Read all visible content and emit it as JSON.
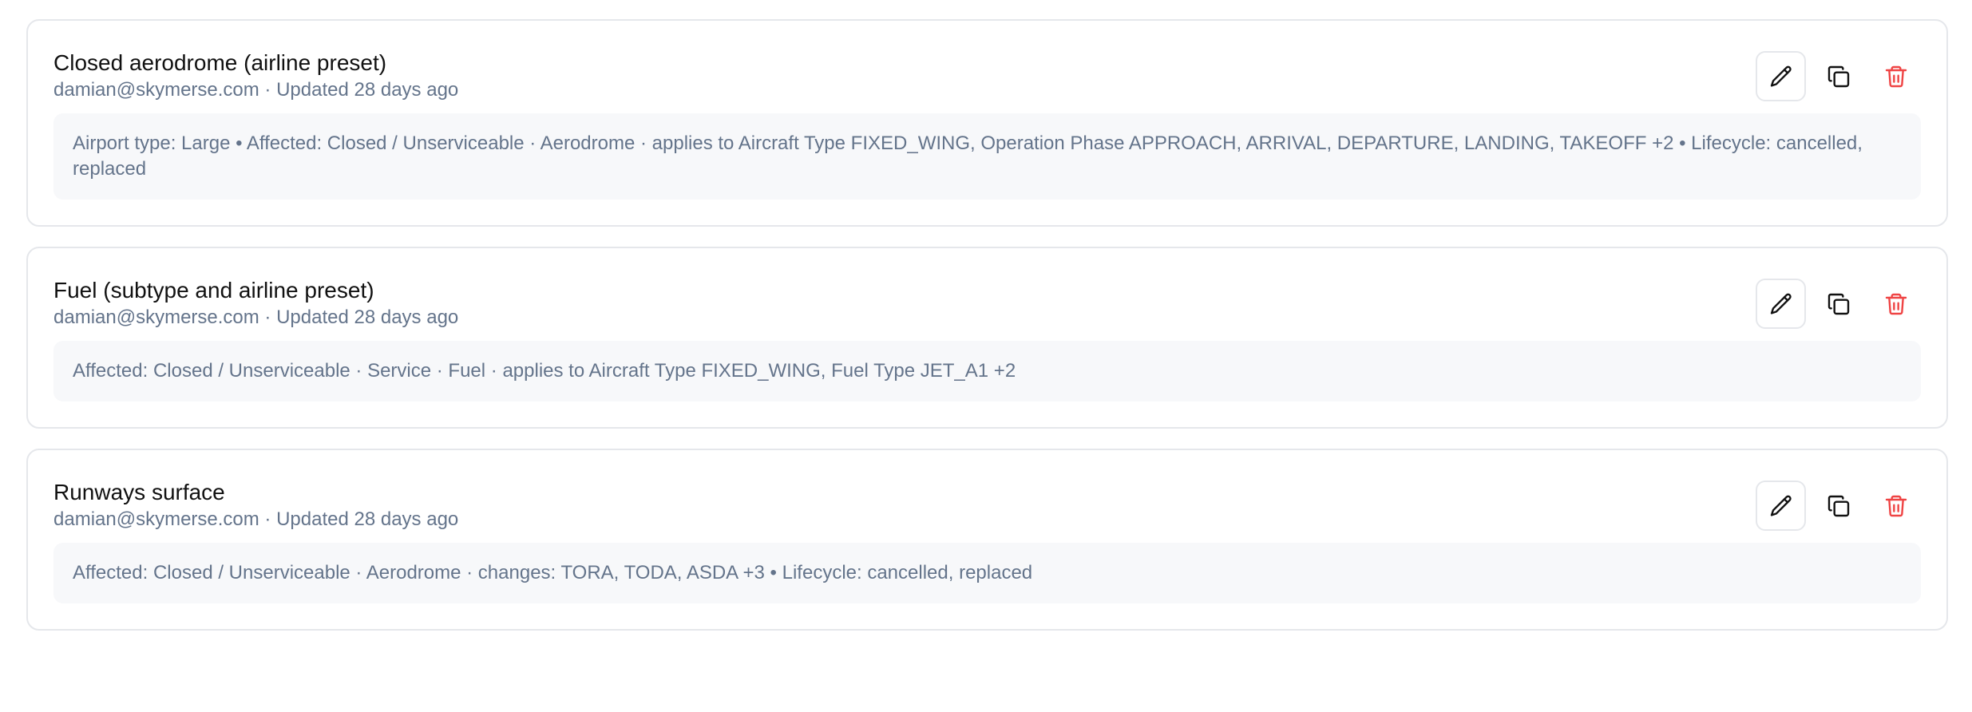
{
  "cards": [
    {
      "title": "Closed aerodrome (airline preset)",
      "meta": "damian@skymerse.com · Updated 28 days ago",
      "description": "Airport type: Large • Affected: Closed / Unserviceable · Aerodrome · applies to Aircraft Type FIXED_WING, Operation Phase APPROACH, ARRIVAL, DEPARTURE, LANDING, TAKEOFF +2 • Lifecycle: cancelled, replaced"
    },
    {
      "title": "Fuel (subtype and airline preset)",
      "meta": "damian@skymerse.com · Updated 28 days ago",
      "description": "Affected: Closed / Unserviceable · Service · Fuel · applies to Aircraft Type FIXED_WING, Fuel Type JET_A1 +2"
    },
    {
      "title": "Runways surface",
      "meta": "damian@skymerse.com · Updated 28 days ago",
      "description": "Affected: Closed / Unserviceable · Aerodrome · changes: TORA, TODA, ASDA +3 • Lifecycle: cancelled, replaced"
    }
  ],
  "actions": {
    "edit_icon": "pencil-icon",
    "duplicate_icon": "copy-icon",
    "delete_icon": "trash-icon"
  },
  "colors": {
    "title": "#111111",
    "muted": "#64748b",
    "border": "#e5e7eb",
    "panel": "#f7f8fa",
    "danger": "#ef4444"
  }
}
